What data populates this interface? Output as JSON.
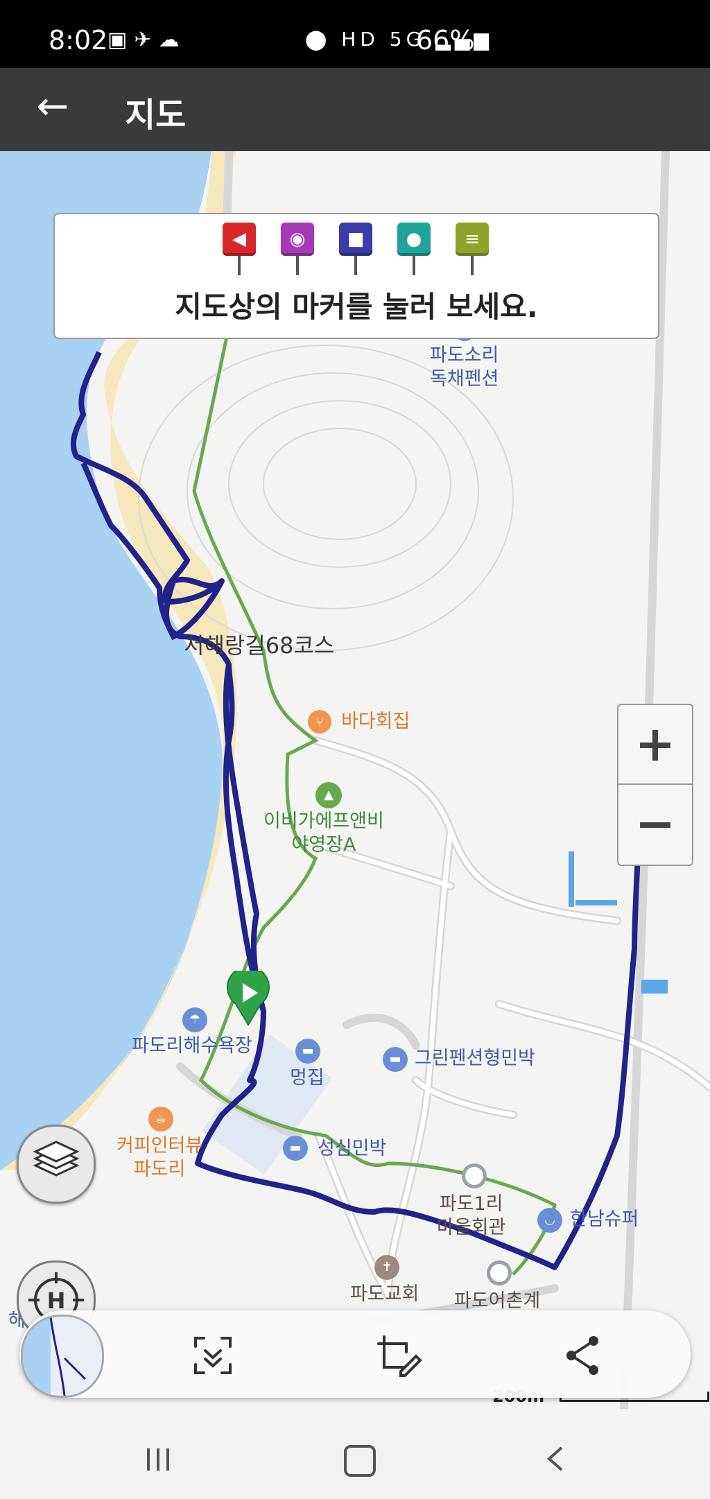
{
  "status_bar": {
    "time": "8:02",
    "battery": "66%",
    "indicators": [
      "gallery-icon",
      "app-icon",
      "cloud-icon",
      "location-icon",
      "hd-icon",
      "5g-icon",
      "signal-icon",
      "battery-icon"
    ]
  },
  "app_bar": {
    "back_icon": "arrow-left-icon",
    "title": "지도"
  },
  "info_card": {
    "marker_types": [
      {
        "icon": "flag-marker-icon",
        "color": "#d8262a"
      },
      {
        "icon": "camera-marker-icon",
        "color": "#a43ab4"
      },
      {
        "icon": "video-marker-icon",
        "color": "#3a3da8"
      },
      {
        "icon": "microphone-marker-icon",
        "color": "#1fa39a"
      },
      {
        "icon": "note-marker-icon",
        "color": "#8ea32a"
      }
    ],
    "text": "지도상의 마커를 눌러 보세요."
  },
  "map": {
    "route_label": "서해랑길68코스",
    "places": {
      "padosori": "파도소리\n독채펜션",
      "bada": "바다회집",
      "ibiga": "이비가에프앤비\n야영장A",
      "beach": "파도리해수욕장",
      "meongjip": "멍집",
      "green_pension": "그린펜션형민박",
      "coffee": "커피인터뷰\n파도리",
      "seongsim": "성심민박",
      "village_hall": "파도1리\n마을회관",
      "hannam": "한남슈퍼",
      "church": "파도교회",
      "fishery": "파도어촌계",
      "edge": "해"
    },
    "colors": {
      "track": "#21228a",
      "trail": "#6aa84f",
      "sea": "#a8d1f2",
      "sand": "#f6e8bd"
    }
  },
  "controls": {
    "zoom_in": "+",
    "zoom_out": "−",
    "layers_icon": "layers-icon",
    "home_icon": "crosshair-h-icon"
  },
  "bottom_bar": {
    "icons": [
      "minimap-thumbnail",
      "scan-download-icon",
      "edit-crop-icon",
      "share-icon"
    ]
  },
  "scale": {
    "label": "200m"
  },
  "nav_bar": {
    "icons": [
      "recent-apps-icon",
      "home-icon",
      "back-icon"
    ]
  }
}
